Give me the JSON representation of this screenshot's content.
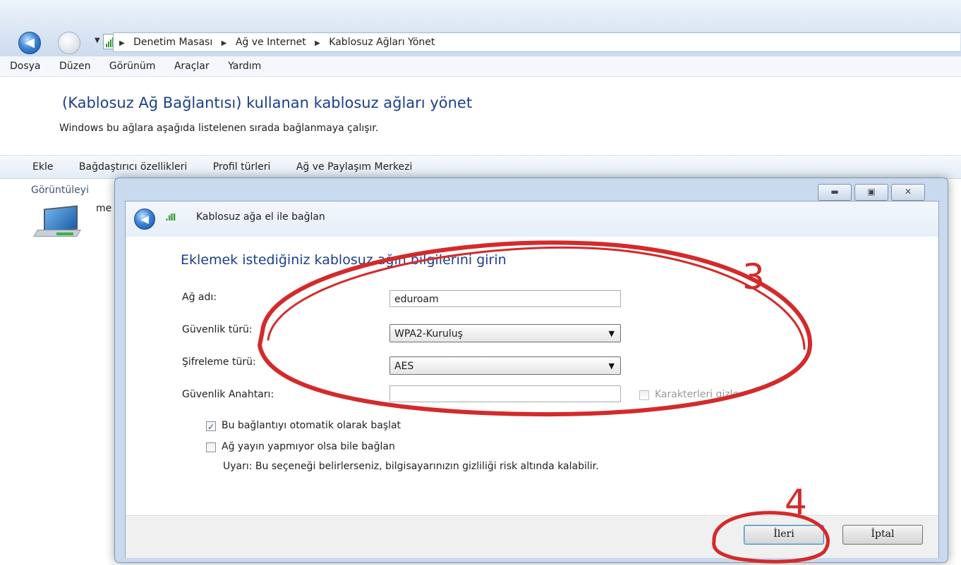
{
  "explorer": {
    "breadcrumb": [
      "Denetim Masası",
      "Ağ ve Internet",
      "Kablosuz Ağları Yönet"
    ],
    "menu": [
      "Dosya",
      "Düzen",
      "Görünüm",
      "Araçlar",
      "Yardım"
    ],
    "title": "(Kablosuz Ağ Bağlantısı) kullanan kablosuz ağları yönet",
    "subtitle": "Windows bu ağlara aşağıda listelenen sırada bağlanmaya çalışır.",
    "commands": [
      "Ekle",
      "Bağdaştırıcı özellikleri",
      "Profil türleri",
      "Ağ ve Paylaşım Merkezi"
    ],
    "view_label": "Görüntüleyi",
    "network_label": "me"
  },
  "dialog": {
    "title": "Kablosuz ağa el ile bağlan",
    "heading": "Eklemek istediğiniz kablosuz ağın bilgilerini girin",
    "network_name_label": "Ağ adı:",
    "network_name_value": "eduroam",
    "security_type_label": "Güvenlik türü:",
    "security_type_value": "WPA2-Kuruluş",
    "encryption_type_label": "Şifreleme türü:",
    "encryption_type_value": "AES",
    "security_key_label": "Güvenlik Anahtarı:",
    "security_key_value": "",
    "hide_chars_label": "Karakterleri gizle",
    "hide_chars_checked": false,
    "auto_connect_label": "Bu bağlantıyı otomatik olarak başlat",
    "auto_connect_checked": true,
    "connect_hidden_label": "Ağ yayın yapmıyor olsa bile bağlan",
    "connect_hidden_checked": false,
    "warning": "Uyarı: Bu seçeneği belirlerseniz, bilgisayarınızın gizliliği risk altında kalabilir.",
    "next_button": "İleri",
    "cancel_button": "İptal"
  },
  "annotations": {
    "step3": "3",
    "step4": "4",
    "color": "#d42a2a"
  }
}
